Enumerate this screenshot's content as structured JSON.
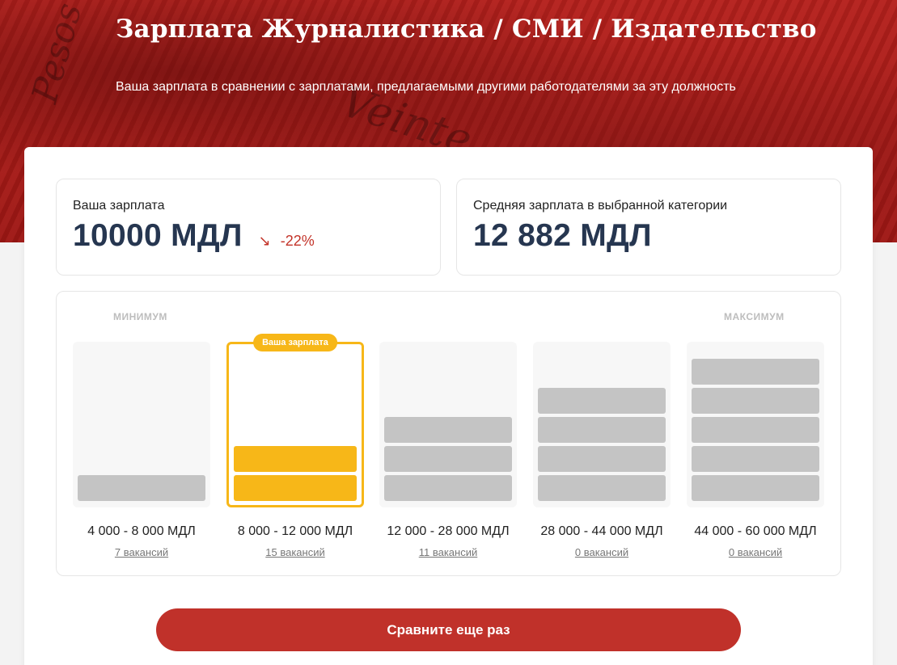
{
  "hero": {
    "title": "Зарплата Журналистика / СМИ / Издательство",
    "subtitle": "Ваша зарплата в сравнении с зарплатами, предлагаемыми другими работодателями за эту должность"
  },
  "your_salary": {
    "label": "Ваша зарплата",
    "value": "10000 МДЛ",
    "delta": "-22%",
    "delta_color": "#c3342a"
  },
  "average_salary": {
    "label": "Средняя зарплата в выбранной категории",
    "value": "12 882 МДЛ"
  },
  "distribution": {
    "min_label": "МИНИМУМ",
    "max_label": "МАКСИМУМ",
    "your_badge": "Ваша зарплата",
    "bins": [
      {
        "range": "4 000 - 8 000 МДЛ",
        "vacancies": "7 вакансий",
        "level": 1,
        "selected": false
      },
      {
        "range": "8 000 - 12 000 МДЛ",
        "vacancies": "15 вакансий",
        "level": 2,
        "selected": true
      },
      {
        "range": "12 000 - 28 000 МДЛ",
        "vacancies": "11 вакансий",
        "level": 3,
        "selected": false
      },
      {
        "range": "28 000 - 44 000 МДЛ",
        "vacancies": "0 вакансий",
        "level": 4,
        "selected": false
      },
      {
        "range": "44 000 - 60 000 МДЛ",
        "vacancies": "0 вакансий",
        "level": 5,
        "selected": false
      }
    ]
  },
  "cta": {
    "label": "Сравните еще раз"
  },
  "colors": {
    "brand_red": "#c0312a",
    "accent_yellow": "#f7b718",
    "value_navy": "#263650"
  }
}
